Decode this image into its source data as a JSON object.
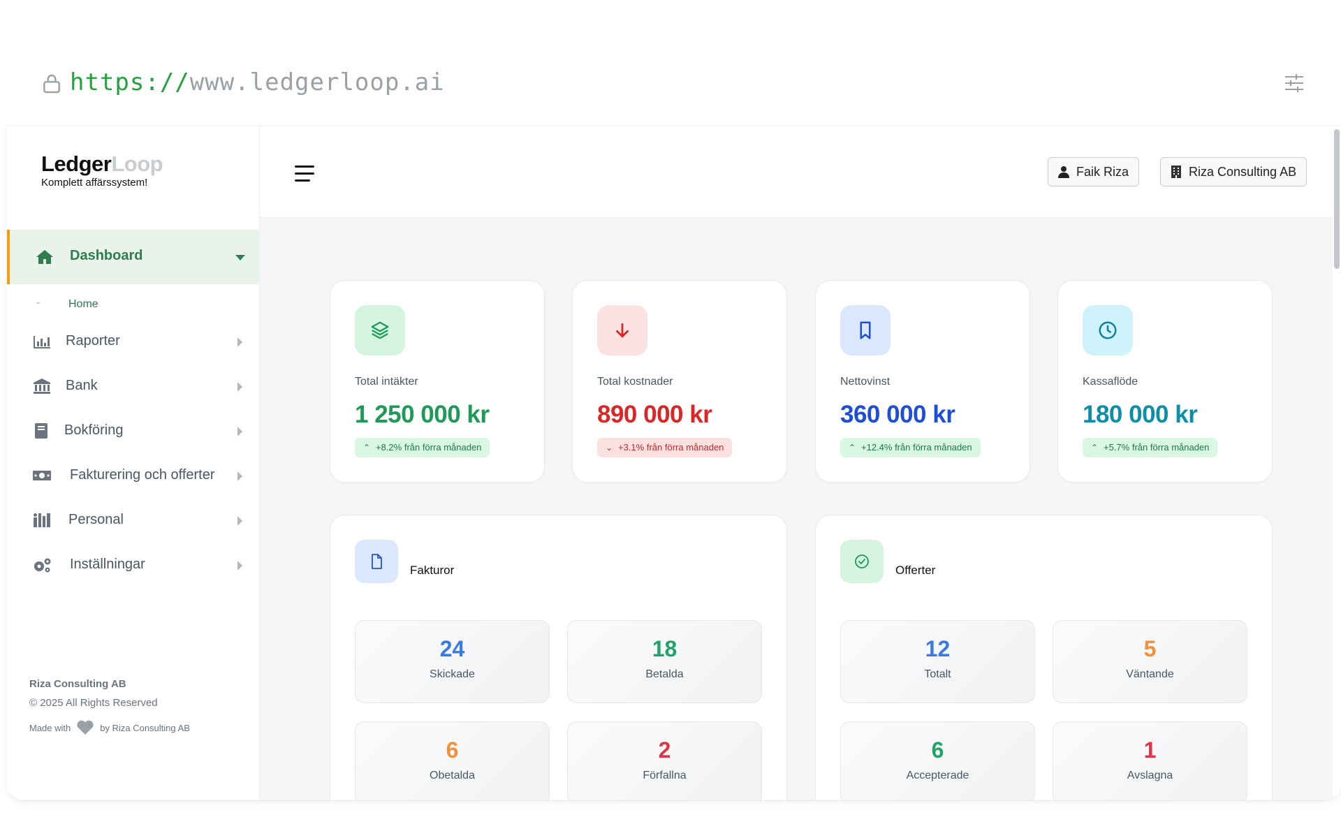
{
  "browser": {
    "url_protocol": "https://",
    "url_host": "www.ledgerloop.ai"
  },
  "brand": {
    "name_part1": "Ledger",
    "name_part2": "Loop",
    "tagline": "Komplett affärssystem!"
  },
  "sidebar": {
    "active": {
      "label": "Dashboard",
      "icon": "home-icon"
    },
    "subitems": [
      {
        "dash": "-",
        "label": "Home"
      }
    ],
    "items": [
      {
        "label": "Raporter",
        "icon": "bar-chart-icon"
      },
      {
        "label": "Bank",
        "icon": "bank-icon"
      },
      {
        "label": "Bokföring",
        "icon": "book-icon"
      },
      {
        "label": "Fakturering och offerter",
        "icon": "money-bill-icon"
      },
      {
        "label": "Personal",
        "icon": "personnel-icon"
      },
      {
        "label": "Inställningar",
        "icon": "gears-icon"
      }
    ],
    "footer": {
      "company": "Riza Consulting AB",
      "copyright": "© 2025 All Rights Reserved",
      "made_with": "Made with",
      "made_by": "by Riza Consulting AB"
    }
  },
  "header": {
    "user": "Faik Riza",
    "company": "Riza Consulting AB"
  },
  "stats": [
    {
      "label": "Total intäkter",
      "value": "1 250 000 kr",
      "change": "+8.2% från förra månaden",
      "trend": "up",
      "color": "#1e9a57",
      "icon": "layers-icon"
    },
    {
      "label": "Total kostnader",
      "value": "890 000 kr",
      "change": "+3.1% från förra månaden",
      "trend": "down",
      "color": "#dc2626",
      "icon": "arrow-down-icon"
    },
    {
      "label": "Nettovinst",
      "value": "360 000 kr",
      "change": "+12.4% från förra månaden",
      "trend": "up",
      "color": "#1d4ed8",
      "icon": "bookmark-icon"
    },
    {
      "label": "Kassaflöde",
      "value": "180 000 kr",
      "change": "+5.7% från förra månaden",
      "trend": "up",
      "color": "#0e8fa8",
      "icon": "clock-icon"
    }
  ],
  "invoices": {
    "title": "Fakturor",
    "icon": "document-icon",
    "tiles": [
      {
        "value": "24",
        "label": "Skickade",
        "color": "#3b7be0"
      },
      {
        "value": "18",
        "label": "Betalda",
        "color": "#22a36b"
      },
      {
        "value": "6",
        "label": "Obetalda",
        "color": "#f0923a"
      },
      {
        "value": "2",
        "label": "Förfallna",
        "color": "#dc3545"
      }
    ]
  },
  "offers": {
    "title": "Offerter",
    "icon": "check-circle-icon",
    "tiles": [
      {
        "value": "12",
        "label": "Totalt",
        "color": "#3b7be0"
      },
      {
        "value": "5",
        "label": "Väntande",
        "color": "#f0923a"
      },
      {
        "value": "6",
        "label": "Accepterade",
        "color": "#22a36b"
      },
      {
        "value": "1",
        "label": "Avslagna",
        "color": "#dc3545"
      }
    ]
  }
}
